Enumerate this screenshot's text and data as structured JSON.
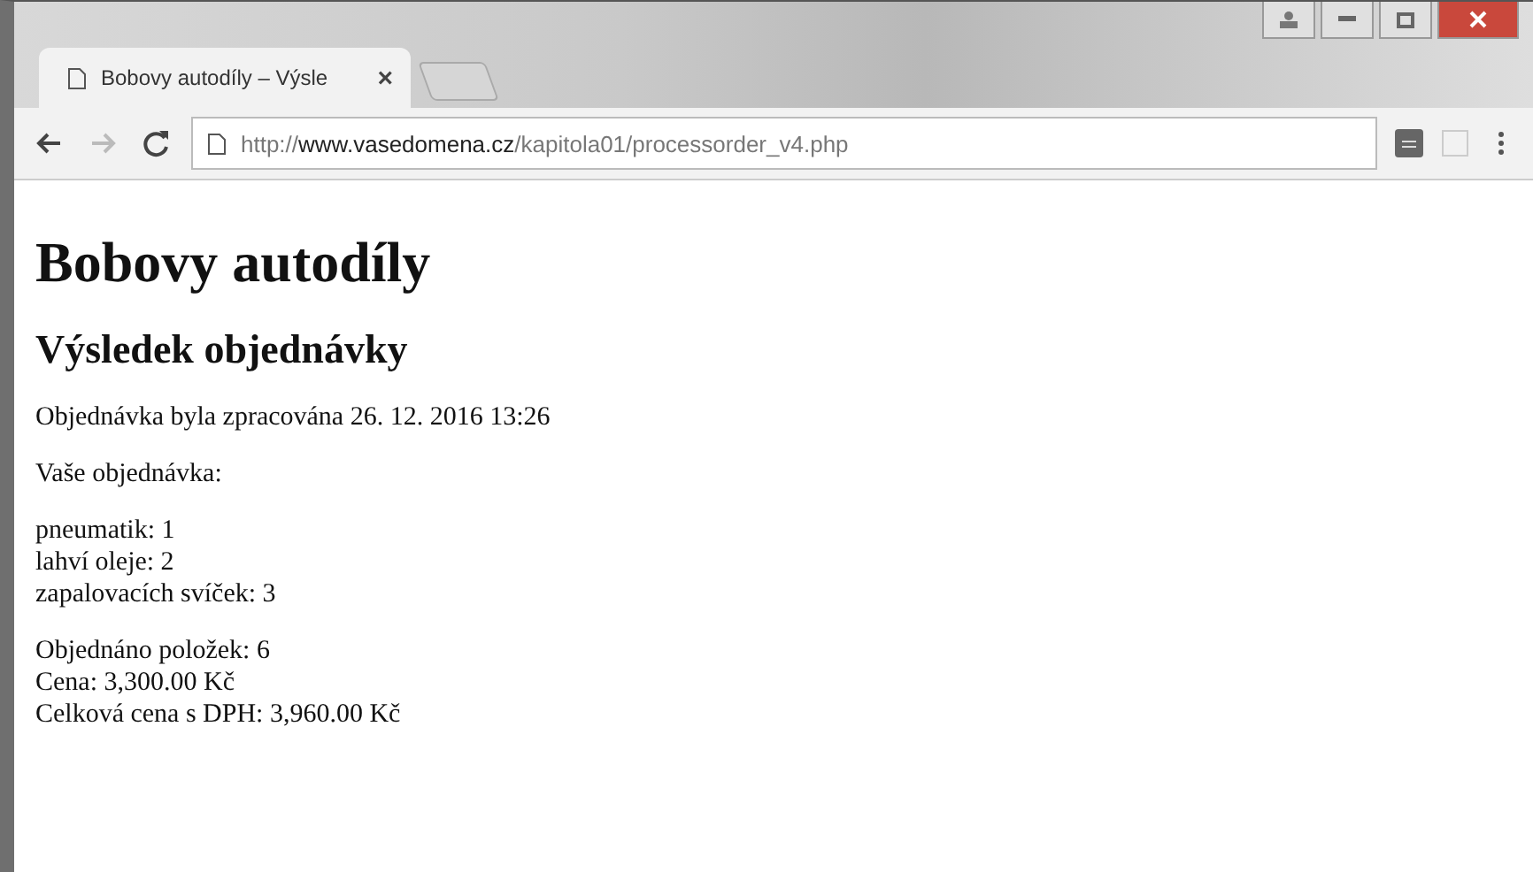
{
  "tab": {
    "title": "Bobovy autodíly – Výsle",
    "close": "×"
  },
  "address_bar": {
    "url": "http://**www.vasedomena.cz**/kapitola01/processorder_v4.php"
  },
  "page": {
    "heading": "Bobovy autodíly",
    "subheading": "Výsledek objednávky",
    "paragraphs": [
      [
        "Objednávka byla zpracována 26. 12. 2016 13:26"
      ],
      [
        "Vaše objednávka:"
      ],
      [
        "pneumatik: 1",
        "lahví oleje: 2",
        "zapalovacích svíček: 3"
      ],
      [
        "Objednáno položek: 6",
        "Cena: 3,300.00 Kč",
        "Celková cena s DPH: 3,960.00 Kč"
      ]
    ]
  }
}
